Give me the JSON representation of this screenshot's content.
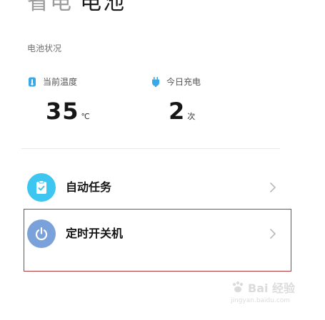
{
  "header": {
    "title_part1": "省电",
    "title_part2": "电池"
  },
  "battery_status": {
    "section_label": "电池状况",
    "temperature": {
      "label": "当前温度",
      "value": "35",
      "unit": "℃",
      "icon": "thermometer-icon"
    },
    "charge_count": {
      "label": "今日充电",
      "value": "2",
      "unit": "次",
      "icon": "plug-icon"
    }
  },
  "menu": {
    "items": [
      {
        "label": "自动任务",
        "icon": "clipboard-check-icon",
        "color": "#3cc6f0"
      },
      {
        "label": "定时开关机",
        "icon": "power-icon",
        "color": "#7aa1d9"
      }
    ]
  },
  "highlight_color": "#b33a3a",
  "watermark": {
    "text": "Bai 经验",
    "url": "jingyan.baidu.com"
  }
}
